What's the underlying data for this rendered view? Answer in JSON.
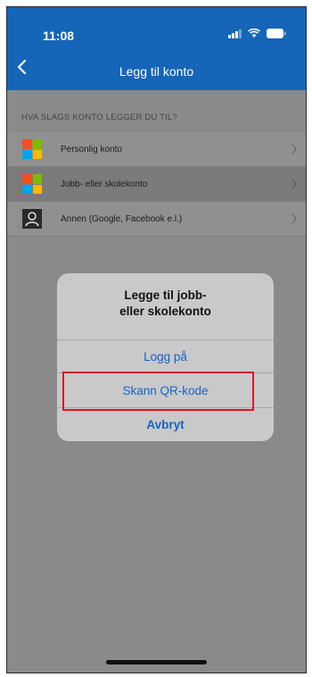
{
  "status_bar": {
    "time": "11:08"
  },
  "header": {
    "title": "Legg til konto"
  },
  "section_label": "HVA SLAGS KONTO LEGGER DU TIL?",
  "accounts": [
    {
      "label": "Personlig konto",
      "icon": "microsoft-logo-icon"
    },
    {
      "label": "Jobb- eller skolekonto",
      "icon": "microsoft-logo-icon"
    },
    {
      "label": "Annen (Google, Facebook e.l.)",
      "icon": "person-icon"
    }
  ],
  "dialog": {
    "title": "Legge til jobb-\neller skolekonto",
    "buttons": [
      "Logg på",
      "Skann QR-kode",
      "Avbryt"
    ]
  },
  "colors": {
    "header": "#1565b8",
    "accent": "#1664c4",
    "highlight": "#d9191f"
  }
}
